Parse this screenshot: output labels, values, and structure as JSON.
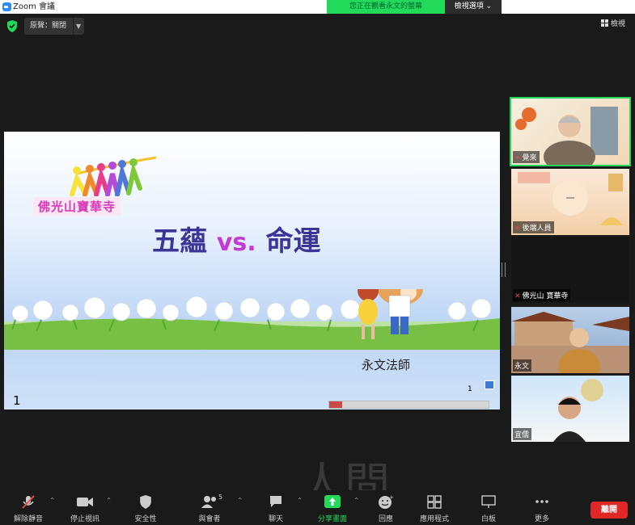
{
  "window": {
    "title": "Zoom 會議"
  },
  "banner": {
    "viewing": "您正在觀看永文的螢幕",
    "view_options": "檢視選項 ⌄"
  },
  "top": {
    "audio_label": "原聲：關閉",
    "gallery_label": "檢視"
  },
  "slide": {
    "org": "佛光山寶華寺",
    "title_a": "五蘊",
    "title_vs": "vs.",
    "title_b": "命運",
    "presenter": "永文法師",
    "page_left": "1",
    "page_right": "1"
  },
  "participants": [
    {
      "name": "覺來"
    },
    {
      "name": "後端人員"
    },
    {
      "name": "佛光山 寶華寺"
    },
    {
      "name": "永文"
    },
    {
      "name": "宜儒"
    }
  ],
  "toolbar": {
    "unmute": "解除靜音",
    "stop_video": "停止視訊",
    "security": "安全性",
    "participants": "與會者",
    "participant_count": "5",
    "chat": "聊天",
    "share": "分享畫面",
    "reactions": "回應",
    "apps": "應用程式",
    "whiteboard": "白板",
    "more": "更多",
    "leave": "離開"
  },
  "colors": {
    "accent_green": "#23d959",
    "leave_red": "#e02828",
    "title_purple": "#3d3498",
    "vs_magenta": "#c23ad3"
  }
}
